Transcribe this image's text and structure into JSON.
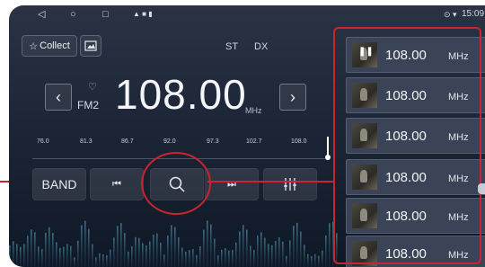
{
  "status_bar": {
    "back_icon": "◁",
    "home_icon": "○",
    "recent_icon": "□",
    "notifications": "▲ ■ ▮",
    "status_icons": "⊙ ▾",
    "time": "15:09"
  },
  "top": {
    "collect_label": "Collect",
    "stereo_label": "ST",
    "dx_label": "DX"
  },
  "tuner": {
    "frequency": "108.00",
    "band": "FM2",
    "unit": "MHz",
    "prev_arrow": "‹",
    "next_arrow": "›",
    "scale_labels": [
      "76.0",
      "81.3",
      "86.7",
      "92.0",
      "97.3",
      "102.7",
      "108.0"
    ]
  },
  "controls": {
    "band_label": "BAND",
    "prev_icon": "⏮",
    "search_icon": "⌕",
    "next_icon": "⏭",
    "eq_icon": "⫶"
  },
  "stations": [
    {
      "freq": "108.00",
      "unit": "MHz",
      "playing": true
    },
    {
      "freq": "108.00",
      "unit": "MHz",
      "playing": false
    },
    {
      "freq": "108.00",
      "unit": "MHz",
      "playing": false
    },
    {
      "freq": "108.00",
      "unit": "MHz",
      "playing": false
    },
    {
      "freq": "108.00",
      "unit": "MHz",
      "playing": false
    },
    {
      "freq": "108.00",
      "unit": "MHz",
      "playing": false
    }
  ],
  "colors": {
    "highlight_red": "#c8262e",
    "background": "#1d2636"
  }
}
